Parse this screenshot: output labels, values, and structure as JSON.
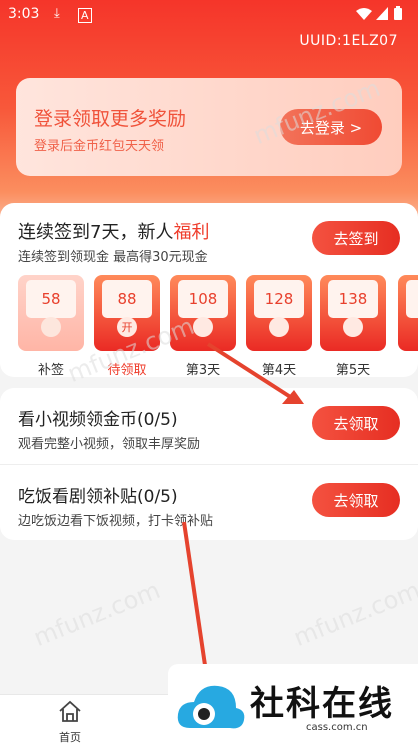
{
  "status_bar": {
    "time": "3:03",
    "icons": [
      "download-icon",
      "notification-a-icon",
      "wifi-icon",
      "signal-icon",
      "battery-icon"
    ]
  },
  "header": {
    "uuid": "UUID:1ELZ07"
  },
  "login_card": {
    "title": "登录领取更多奖励",
    "subtitle": "登录后金币红包天天领",
    "button": "去登录 >"
  },
  "signin": {
    "title_main": "连续签到7天，新人",
    "title_highlight": "福利",
    "subtitle": "连续签到领现金 最高得30元现金",
    "button": "去签到",
    "days": [
      {
        "amount": "58",
        "coin": "",
        "label": "补签",
        "state": "light"
      },
      {
        "amount": "88",
        "coin": "开",
        "label": "待领取",
        "state": "active"
      },
      {
        "amount": "108",
        "coin": "",
        "label": "第3天",
        "state": "red"
      },
      {
        "amount": "128",
        "coin": "",
        "label": "第4天",
        "state": "red"
      },
      {
        "amount": "138",
        "coin": "",
        "label": "第5天",
        "state": "red"
      },
      {
        "amount": "",
        "coin": "",
        "label": "",
        "state": "red"
      }
    ]
  },
  "tasks": [
    {
      "title": "看小视频领金币(0/5)",
      "subtitle": "观看完整小视频，领取丰厚奖励",
      "button": "去领取"
    },
    {
      "title": "吃饭看剧领补贴(0/5)",
      "subtitle": "边吃饭边看下饭视频，打卡领补贴",
      "button": "去领取"
    }
  ],
  "bottom_nav": {
    "home_label": "首页"
  },
  "watermark": {
    "text": "mfunz.com",
    "brand_name": "社科在线",
    "brand_site": "cass.com.cn"
  },
  "colors": {
    "primary_red": "#ef3c2b",
    "hero_top": "#f5352a",
    "arrow": "#e8402d"
  }
}
